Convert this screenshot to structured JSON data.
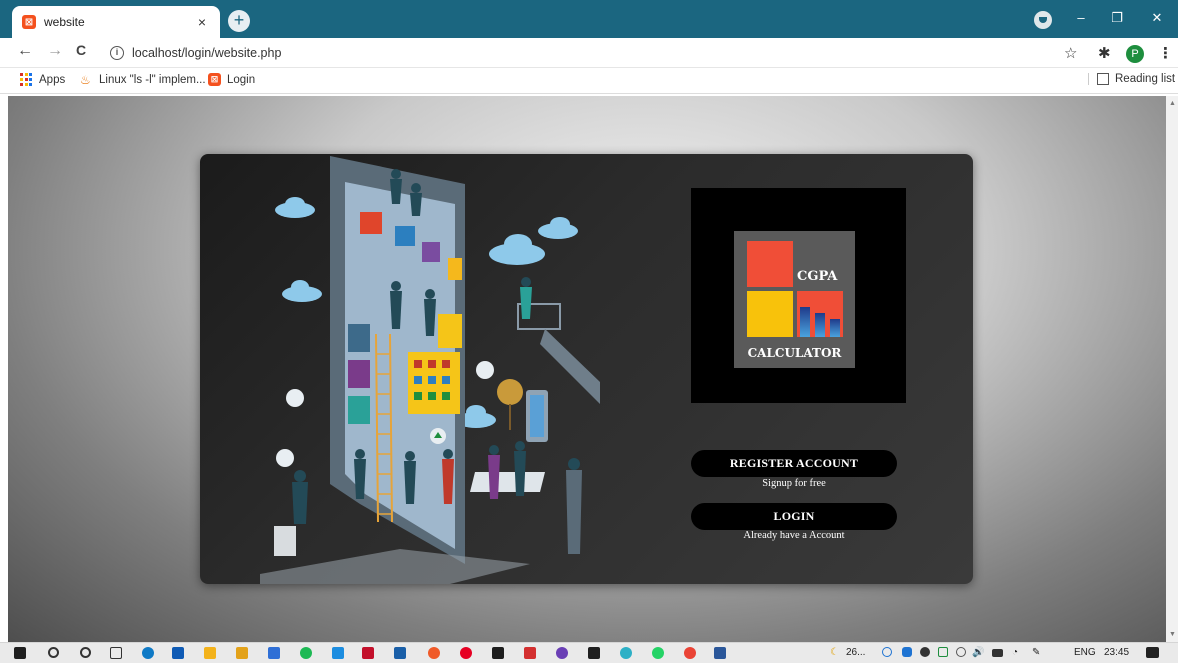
{
  "browser": {
    "tab_title": "website",
    "tab_close": "×",
    "new_tab": "+",
    "url": "localhost/login/website.php",
    "nav": {
      "back": "←",
      "forward": "→",
      "reload": "C"
    },
    "profile_initial": "P",
    "tools": {
      "star": "☆",
      "extensions": "✱",
      "menu": "⋮"
    },
    "window": {
      "minimize": "–",
      "restore": "❐",
      "close": "✕"
    }
  },
  "bookmarks": {
    "items": [
      {
        "label": "Apps",
        "icon": "apps-grid-icon"
      },
      {
        "label": "Linux \"ls -l\" implem...",
        "icon": "java-icon"
      },
      {
        "label": "Login",
        "icon": "xampp-icon"
      }
    ],
    "reading_list": "Reading list"
  },
  "logo": {
    "line1": "CGPA",
    "line2": "CALCULATOR"
  },
  "actions": {
    "register_label": "REGISTER ACCOUNT",
    "register_caption": "Signup for free",
    "login_label": "LOGIN",
    "login_caption": "Already have a Account"
  },
  "taskbar": {
    "weather": "26...",
    "language": "ENG",
    "time": "23:45"
  },
  "colors": {
    "chrome_bar": "#1b6680",
    "logo_red": "#f04e37",
    "logo_yellow": "#f8c20b",
    "button_bg": "#000000"
  }
}
